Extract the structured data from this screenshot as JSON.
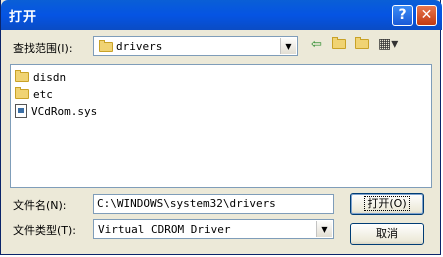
{
  "window": {
    "title": "打开",
    "help_glyph": "?",
    "close_glyph": "✕"
  },
  "lookin": {
    "label": "查找范围(I):",
    "value": "drivers"
  },
  "toolbar": {
    "back_icon": "back-arrow-icon",
    "up_icon": "up-folder-icon",
    "new_folder_icon": "new-folder-icon",
    "views_icon": "views-menu-icon"
  },
  "files": [
    {
      "name": "disdn",
      "type": "folder"
    },
    {
      "name": "etc",
      "type": "folder"
    },
    {
      "name": "VCdRom.sys",
      "type": "sys"
    }
  ],
  "filename": {
    "label": "文件名(N):",
    "value": "C:\\WINDOWS\\system32\\drivers"
  },
  "filetype": {
    "label": "文件类型(T):",
    "value": "Virtual CDROM Driver"
  },
  "buttons": {
    "open": "打开(O)",
    "cancel": "取消"
  }
}
